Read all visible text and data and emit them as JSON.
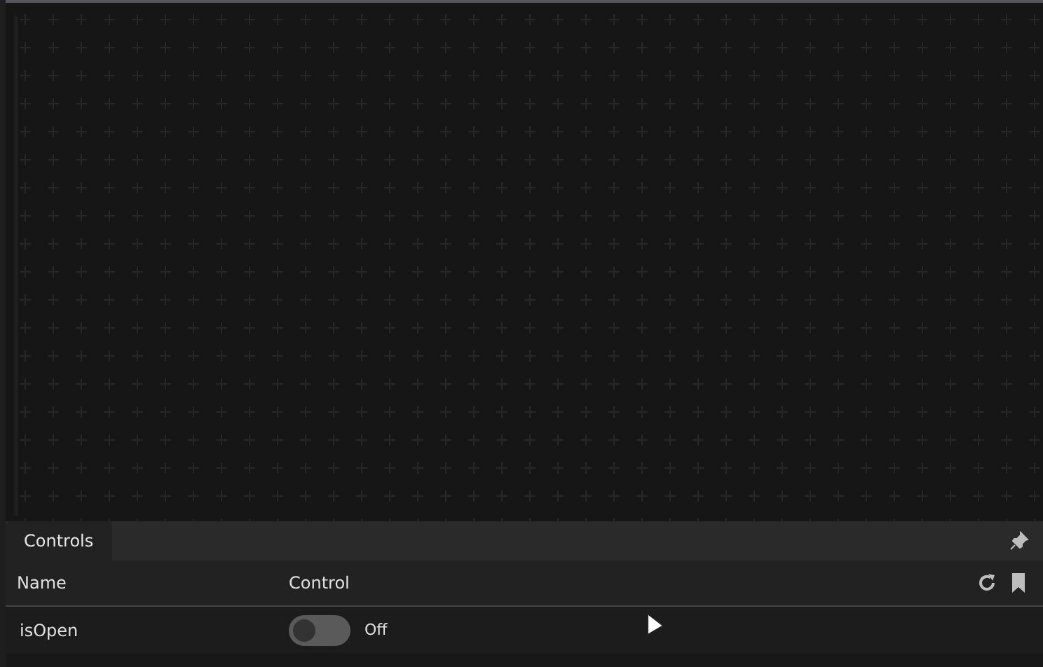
{
  "panel": {
    "tabs": [
      {
        "label": "Controls",
        "selected": true
      }
    ],
    "columns": [
      "Name",
      "Control"
    ],
    "rows": [
      {
        "name": "isOpen",
        "kind": "boolean",
        "on": false,
        "value_label": "Off"
      }
    ]
  }
}
